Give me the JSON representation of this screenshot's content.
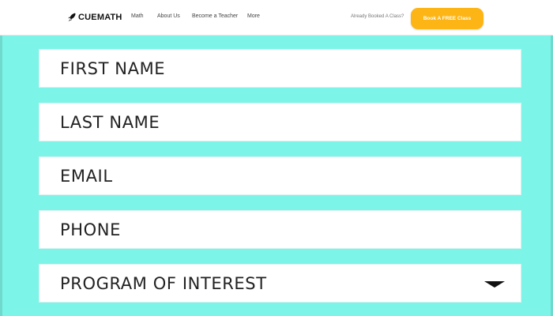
{
  "navbar": {
    "brand": "CUEMATH",
    "brand_icon": "rocket-icon",
    "items": [
      {
        "label": "Math"
      },
      {
        "label": "About Us"
      },
      {
        "label": "Become a Teacher"
      },
      {
        "label": "More"
      }
    ],
    "booked_text": "Already Booked A Class?",
    "cta_label": "Book A FREE Class",
    "cta_color": "#fdb515"
  },
  "form": {
    "background_color": "#7cf5e8",
    "fields": [
      {
        "placeholder": "FIRST NAME",
        "value": ""
      },
      {
        "placeholder": "LAST NAME",
        "value": ""
      },
      {
        "placeholder": "EMAIL",
        "value": ""
      },
      {
        "placeholder": "PHONE",
        "value": ""
      }
    ],
    "program_select": {
      "selected": "PROGRAM OF INTEREST",
      "icon": "caret-down-icon"
    }
  }
}
